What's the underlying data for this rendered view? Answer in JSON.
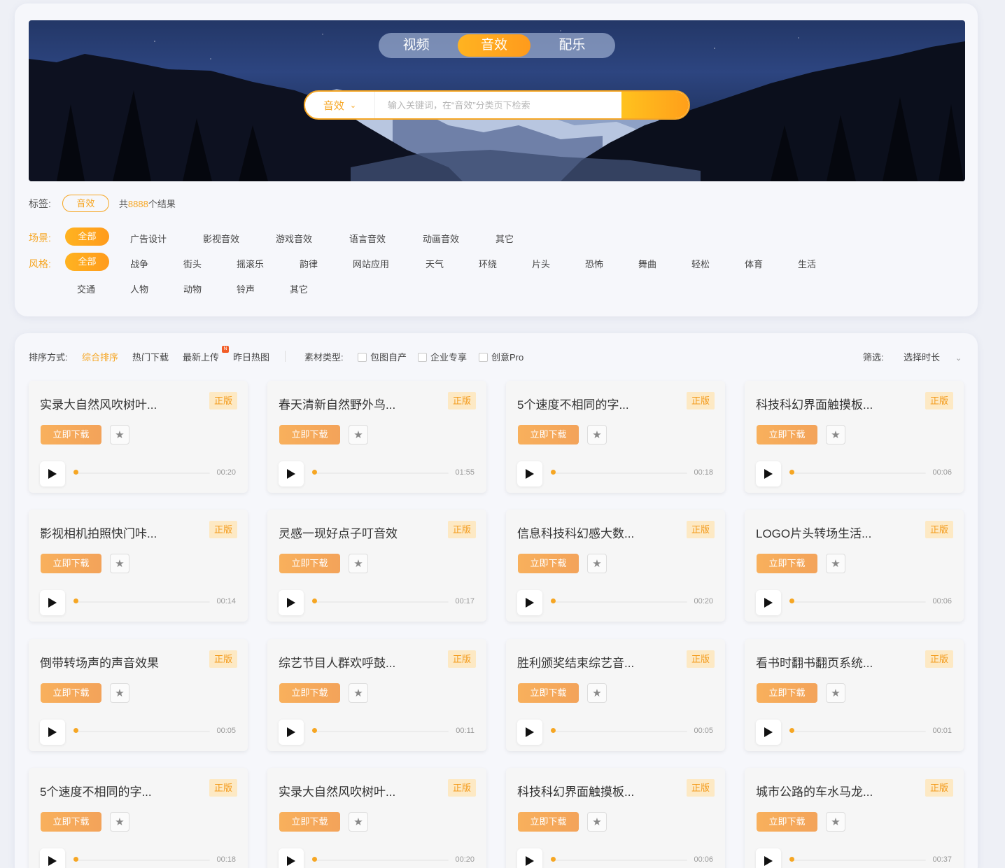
{
  "header": {
    "tabs": [
      {
        "label": "视频",
        "active": false
      },
      {
        "label": "音效",
        "active": true
      },
      {
        "label": "配乐",
        "active": false
      }
    ],
    "search": {
      "category": "音效",
      "placeholder": "输入关键词，在“音效”分类页下检索"
    }
  },
  "tags": {
    "label": "标签:",
    "active_tag": "音效",
    "result_prefix": "共",
    "result_count": "8888",
    "result_suffix": "个结果"
  },
  "filters": {
    "scene": {
      "label": "场景:",
      "options": [
        "全部",
        "广告设计",
        "影视音效",
        "游戏音效",
        "语言音效",
        "动画音效",
        "其它"
      ]
    },
    "style": {
      "label": "风格:",
      "options": [
        "全部",
        "战争",
        "街头",
        "摇滚乐",
        "韵律",
        "网站应用",
        "天气",
        "环绕",
        "片头",
        "恐怖",
        "舞曲",
        "轻松",
        "体育",
        "生活",
        "交通",
        "人物",
        "动物",
        "铃声",
        "其它"
      ]
    }
  },
  "sortbar": {
    "label": "排序方式:",
    "options": [
      "综合排序",
      "热门下载",
      "最新上传",
      "昨日热图"
    ],
    "new_badge": "N",
    "material_label": "素材类型:",
    "material_types": [
      "包图自产",
      "企业专享",
      "创意Pro"
    ],
    "filter_label": "筛选:",
    "duration_select": "选择时长"
  },
  "card_common": {
    "badge": "正版",
    "download": "立即下载"
  },
  "cards": [
    {
      "title": "实录大自然风吹树叶...",
      "duration": "00:20"
    },
    {
      "title": "春天清新自然野外鸟...",
      "duration": "01:55"
    },
    {
      "title": "5个速度不相同的字...",
      "duration": "00:18"
    },
    {
      "title": "科技科幻界面触摸板...",
      "duration": "00:06"
    },
    {
      "title": "影视相机拍照快门咔...",
      "duration": "00:14"
    },
    {
      "title": "灵感一现好点子叮音效",
      "duration": "00:17"
    },
    {
      "title": "信息科技科幻感大数...",
      "duration": "00:20"
    },
    {
      "title": "LOGO片头转场生活...",
      "duration": "00:06"
    },
    {
      "title": "倒带转场声的声音效果",
      "duration": "00:05"
    },
    {
      "title": "综艺节目人群欢呼鼓...",
      "duration": "00:11"
    },
    {
      "title": "胜利颁奖结束综艺音...",
      "duration": "00:05"
    },
    {
      "title": "看书时翻书翻页系统...",
      "duration": "00:01"
    },
    {
      "title": "5个速度不相同的字...",
      "duration": "00:18"
    },
    {
      "title": "实录大自然风吹树叶...",
      "duration": "00:20"
    },
    {
      "title": "科技科幻界面触摸板...",
      "duration": "00:06"
    },
    {
      "title": "城市公路的车水马龙...",
      "duration": "00:37"
    }
  ],
  "colors": {
    "accent": "#f6a623",
    "badge_bg": "#fde9c4",
    "page_bg": "#eef0f6"
  }
}
